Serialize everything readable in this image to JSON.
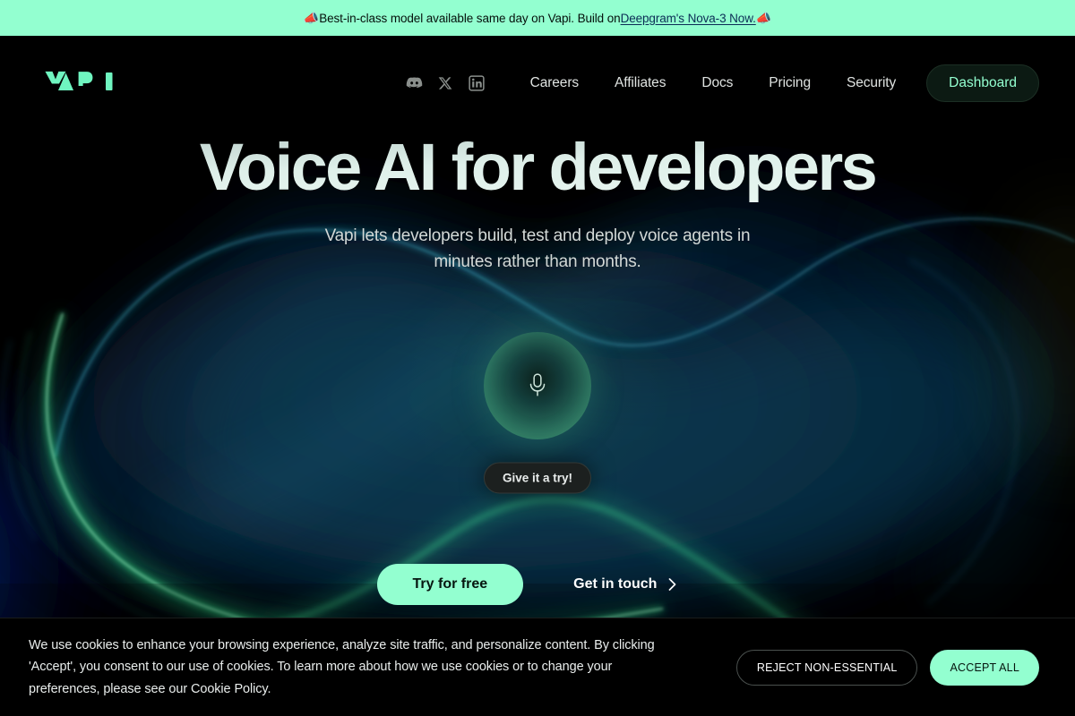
{
  "announcement": {
    "emoji_left": "📣",
    "emoji_right": "📣",
    "text": "Best-in-class model available same day on Vapi. Build on ",
    "link_text": "Deepgram's Nova-3 Now."
  },
  "nav": {
    "logo_text": "VAPI",
    "socials": [
      {
        "name": "discord-icon",
        "label": "Discord"
      },
      {
        "name": "x-icon",
        "label": "X"
      },
      {
        "name": "linkedin-icon",
        "label": "LinkedIn"
      }
    ],
    "links": [
      {
        "label": "Careers"
      },
      {
        "label": "Affiliates"
      },
      {
        "label": "Docs"
      },
      {
        "label": "Pricing"
      },
      {
        "label": "Security"
      }
    ],
    "dashboard_label": "Dashboard"
  },
  "hero": {
    "headline": "Voice AI for developers",
    "subhead_line1": "Vapi lets developers build, test and deploy voice agents in",
    "subhead_line2": "minutes rather than months.",
    "orb_icon": "microphone-icon",
    "tooltip": "Give it a try!",
    "primary_cta": "Try for free",
    "secondary_cta": "Get in touch",
    "secondary_cta_icon": "chevron-right-icon"
  },
  "cookie": {
    "text": "We use cookies to enhance your browsing experience, analyze site traffic, and personalize content. By clicking 'Accept', you consent to our use of cookies. To learn more about how we use cookies or to change your preferences, please see our Cookie Policy.",
    "reject_label": "REJECT NON-ESSENTIAL",
    "accept_label": "ACCEPT ALL"
  },
  "colors": {
    "mint": "#93FFD0",
    "background": "#000000",
    "link_blue": "#0b2c55"
  }
}
